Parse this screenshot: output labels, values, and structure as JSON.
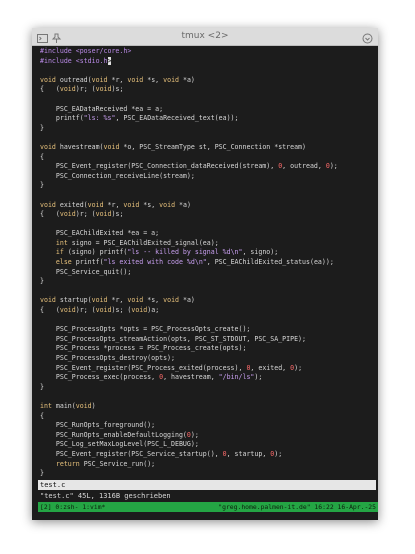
{
  "window": {
    "title": "tmux <2>"
  },
  "editor": {
    "lines": [
      [
        {
          "t": "#include <poser/core.h>",
          "c": "p"
        }
      ],
      [
        {
          "t": "#include <stdio.h",
          "c": "p"
        },
        {
          "t": ">",
          "c": "cursor"
        }
      ],
      [],
      [
        {
          "t": "void ",
          "c": "k"
        },
        {
          "t": "outread(",
          "c": "f"
        },
        {
          "t": "void ",
          "c": "k"
        },
        {
          "t": "*r, ",
          "c": "f"
        },
        {
          "t": "void ",
          "c": "k"
        },
        {
          "t": "*s, ",
          "c": "f"
        },
        {
          "t": "void ",
          "c": "k"
        },
        {
          "t": "*a)",
          "c": "f"
        }
      ],
      [
        {
          "t": "{   (",
          "c": "f"
        },
        {
          "t": "void",
          "c": "k"
        },
        {
          "t": ")r; (",
          "c": "f"
        },
        {
          "t": "void",
          "c": "k"
        },
        {
          "t": ")s;",
          "c": "f"
        }
      ],
      [],
      [
        {
          "t": "    PSC_EADataReceived *ea = a;",
          "c": "f"
        }
      ],
      [
        {
          "t": "    printf(",
          "c": "f"
        },
        {
          "t": "\"ls: %s\"",
          "c": "s"
        },
        {
          "t": ", PSC_EADataReceived_text(ea));",
          "c": "f"
        }
      ],
      [
        {
          "t": "}",
          "c": "f"
        }
      ],
      [],
      [
        {
          "t": "void ",
          "c": "k"
        },
        {
          "t": "havestream(",
          "c": "f"
        },
        {
          "t": "void ",
          "c": "k"
        },
        {
          "t": "*o, PSC_StreamType st, PSC_Connection *stream)",
          "c": "f"
        }
      ],
      [
        {
          "t": "{",
          "c": "f"
        }
      ],
      [
        {
          "t": "    PSC_Event_register(PSC_Connection_dataReceived(stream), ",
          "c": "f"
        },
        {
          "t": "0",
          "c": "n"
        },
        {
          "t": ", outread, ",
          "c": "f"
        },
        {
          "t": "0",
          "c": "n"
        },
        {
          "t": ");",
          "c": "f"
        }
      ],
      [
        {
          "t": "    PSC_Connection_receiveLine(stream);",
          "c": "f"
        }
      ],
      [
        {
          "t": "}",
          "c": "f"
        }
      ],
      [],
      [
        {
          "t": "void ",
          "c": "k"
        },
        {
          "t": "exited(",
          "c": "f"
        },
        {
          "t": "void ",
          "c": "k"
        },
        {
          "t": "*r, ",
          "c": "f"
        },
        {
          "t": "void ",
          "c": "k"
        },
        {
          "t": "*s, ",
          "c": "f"
        },
        {
          "t": "void ",
          "c": "k"
        },
        {
          "t": "*a)",
          "c": "f"
        }
      ],
      [
        {
          "t": "{   (",
          "c": "f"
        },
        {
          "t": "void",
          "c": "k"
        },
        {
          "t": ")r; (",
          "c": "f"
        },
        {
          "t": "void",
          "c": "k"
        },
        {
          "t": ")s;",
          "c": "f"
        }
      ],
      [],
      [
        {
          "t": "    PSC_EAChildExited *ea = a;",
          "c": "f"
        }
      ],
      [
        {
          "t": "    ",
          "c": "f"
        },
        {
          "t": "int ",
          "c": "k"
        },
        {
          "t": "signo = PSC_EAChildExited_signal(ea);",
          "c": "f"
        }
      ],
      [
        {
          "t": "    ",
          "c": "f"
        },
        {
          "t": "if ",
          "c": "k"
        },
        {
          "t": "(signo) printf(",
          "c": "f"
        },
        {
          "t": "\"ls -- killed by signal %d\\n\"",
          "c": "s"
        },
        {
          "t": ", signo);",
          "c": "f"
        }
      ],
      [
        {
          "t": "    ",
          "c": "f"
        },
        {
          "t": "else ",
          "c": "k"
        },
        {
          "t": "printf(",
          "c": "f"
        },
        {
          "t": "\"ls exited with code %d\\n\"",
          "c": "s"
        },
        {
          "t": ", PSC_EAChildExited_status(ea));",
          "c": "f"
        }
      ],
      [
        {
          "t": "    PSC_Service_quit();",
          "c": "f"
        }
      ],
      [
        {
          "t": "}",
          "c": "f"
        }
      ],
      [],
      [
        {
          "t": "void ",
          "c": "k"
        },
        {
          "t": "startup(",
          "c": "f"
        },
        {
          "t": "void ",
          "c": "k"
        },
        {
          "t": "*r, ",
          "c": "f"
        },
        {
          "t": "void ",
          "c": "k"
        },
        {
          "t": "*s, ",
          "c": "f"
        },
        {
          "t": "void ",
          "c": "k"
        },
        {
          "t": "*a)",
          "c": "f"
        }
      ],
      [
        {
          "t": "{   (",
          "c": "f"
        },
        {
          "t": "void",
          "c": "k"
        },
        {
          "t": ")r; (",
          "c": "f"
        },
        {
          "t": "void",
          "c": "k"
        },
        {
          "t": ")s; (",
          "c": "f"
        },
        {
          "t": "void",
          "c": "k"
        },
        {
          "t": ")a;",
          "c": "f"
        }
      ],
      [],
      [
        {
          "t": "    PSC_ProcessOpts *opts = PSC_ProcessOpts_create();",
          "c": "f"
        }
      ],
      [
        {
          "t": "    PSC_ProcessOpts_streamAction(opts, PSC_ST_STDOUT, PSC_SA_PIPE);",
          "c": "f"
        }
      ],
      [
        {
          "t": "    PSC_Process *process = PSC_Process_create(opts);",
          "c": "f"
        }
      ],
      [
        {
          "t": "    PSC_ProcessOpts_destroy(opts);",
          "c": "f"
        }
      ],
      [
        {
          "t": "    PSC_Event_register(PSC_Process_exited(process), ",
          "c": "f"
        },
        {
          "t": "0",
          "c": "n"
        },
        {
          "t": ", exited, ",
          "c": "f"
        },
        {
          "t": "0",
          "c": "n"
        },
        {
          "t": ");",
          "c": "f"
        }
      ],
      [
        {
          "t": "    PSC_Process_exec(process, ",
          "c": "f"
        },
        {
          "t": "0",
          "c": "n"
        },
        {
          "t": ", havestream, ",
          "c": "f"
        },
        {
          "t": "\"/bin/ls\"",
          "c": "s"
        },
        {
          "t": ");",
          "c": "f"
        }
      ],
      [
        {
          "t": "}",
          "c": "f"
        }
      ],
      [],
      [
        {
          "t": "int ",
          "c": "k"
        },
        {
          "t": "main(",
          "c": "f"
        },
        {
          "t": "void",
          "c": "k"
        },
        {
          "t": ")",
          "c": "f"
        }
      ],
      [
        {
          "t": "{",
          "c": "f"
        }
      ],
      [
        {
          "t": "    PSC_RunOpts_foreground();",
          "c": "f"
        }
      ],
      [
        {
          "t": "    PSC_RunOpts_enableDefaultLogging(",
          "c": "f"
        },
        {
          "t": "0",
          "c": "n"
        },
        {
          "t": ");",
          "c": "f"
        }
      ],
      [
        {
          "t": "    PSC_Log_setMaxLogLevel(PSC_L_DEBUG);",
          "c": "f"
        }
      ],
      [
        {
          "t": "    PSC_Event_register(PSC_Service_startup(), ",
          "c": "f"
        },
        {
          "t": "0",
          "c": "n"
        },
        {
          "t": ", startup, ",
          "c": "f"
        },
        {
          "t": "0",
          "c": "n"
        },
        {
          "t": ");",
          "c": "f"
        }
      ],
      [
        {
          "t": "    ",
          "c": "f"
        },
        {
          "t": "return ",
          "c": "k"
        },
        {
          "t": "PSC_Service_run();",
          "c": "f"
        }
      ],
      [
        {
          "t": "}",
          "c": "f"
        }
      ]
    ]
  },
  "vim": {
    "filename": "test.c",
    "message": "\"test.c\" 45L, 1316B geschrieben"
  },
  "tmux": {
    "left": "[2] 0:zsh- 1:vim*",
    "right": "\"greg.home.palmen-it.de\" 16:22 16-Apr.-25"
  },
  "colors": {
    "titlebar": "#dcdcdc",
    "terminal_bg": "#1c1c1c",
    "status_bg": "#24a544",
    "keyword": "#e6c07b",
    "string": "#c89ff0",
    "number": "#ff6b6b"
  },
  "icons": {
    "left": "terminal-icon",
    "pin": "pin-icon",
    "right": "window-controls-icon"
  }
}
